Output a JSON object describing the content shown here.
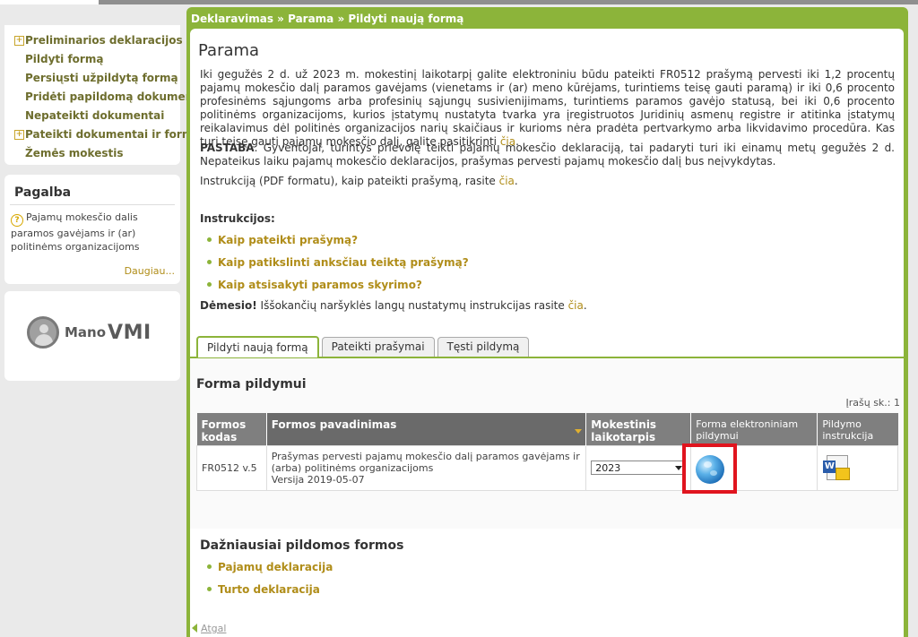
{
  "sidebar": {
    "menu": [
      {
        "label": "Preliminarios deklaracijos",
        "expandable": true
      },
      {
        "label": "Pildyti formą",
        "expandable": false
      },
      {
        "label": "Persiųsti užpildytą formą",
        "expandable": false
      },
      {
        "label": "Pridėti papildomą dokumentą",
        "expandable": false
      },
      {
        "label": "Nepateikti dokumentai",
        "expandable": false
      },
      {
        "label": "Pateikti dokumentai ir formos",
        "expandable": true
      },
      {
        "label": "Žemės mokestis",
        "expandable": false
      }
    ],
    "help": {
      "title": "Pagalba",
      "item": "Pajamų mokesčio dalis paramos gavėjams ir (ar) politinėms organizacijoms",
      "more": "Daugiau..."
    },
    "logo": {
      "prefix": "Mano",
      "name": "VMI"
    }
  },
  "breadcrumb": "Deklaravimas » Parama » Pildyti naują formą",
  "page": {
    "title": "Parama",
    "intro": "Iki gegužės 2 d. už 2023 m. mokestinį laikotarpį galite elektroniniu būdu pateikti FR0512 prašymą pervesti iki 1,2 procentų pajamų mokesčio dalį paramos gavėjams (vienetams ir (ar) meno kūrėjams, turintiems teisę gauti paramą) ir iki 0,6 procento profesinėms sąjungoms arba profesinių sąjungų susivienijimams, turintiems paramos gavėjo statusą, bei iki 0,6 procento politinėms organizacijoms, kurios įstatymų nustatyta tvarka yra įregistruotos Juridinių asmenų registre ir atitinka įstatymų reikalavimus dėl politinės organizacijos narių skaičiaus ir kurioms nėra pradėta pertvarkymo arba likvidavimo procedūra. Kas turi teisę gauti pajamų mokesčio dalį, galite pasitikrinti ",
    "intro_link": "čia",
    "intro_end": ".",
    "note_label": "PASTABA",
    "note_text": ". Gyventojai, turintys prievolę teikti pajamų mokesčio deklaraciją, tai padaryti turi iki einamų metų gegužės 2 d. Nepateikus laiku pajamų mokesčio deklaracijos, prašymas pervesti pajamų mokesčio dalį bus neįvykdytas.",
    "pdf_text": "Instrukciją (PDF formatu), kaip pateikti prašymą, rasite ",
    "pdf_link": "čia",
    "pdf_end": ".",
    "instructions_title": "Instrukcijos:",
    "instructions": [
      "Kaip pateikti prašymą?",
      "Kaip patikslinti anksčiau teiktą prašymą?",
      "Kaip atsisakyti paramos skyrimo?"
    ],
    "attention_label": "Dėmesio!",
    "attention_text": " Iššokančių naršyklės langų nustatymų instrukcijas rasite ",
    "attention_link": "čia",
    "attention_end": "."
  },
  "tabs": [
    "Pildyti naują formą",
    "Pateikti prašymai",
    "Tęsti pildymą"
  ],
  "forms": {
    "title": "Forma pildymui",
    "count": "Įrašų sk.: 1",
    "headers": [
      "Formos kodas",
      "Formos pavadinimas",
      "Mokestinis laikotarpis",
      "Forma elektroniniam pildymui",
      "Pildymo instrukcija"
    ],
    "row": {
      "code": "FR0512 v.5",
      "name": "Prašymas pervesti pajamų mokesčio dalį paramos gavėjams ir (arba) politinėms organizacijoms",
      "version": "Versija 2019-05-07",
      "period": "2023"
    }
  },
  "frequent": {
    "title": "Dažniausiai pildomos formos",
    "items": [
      "Pajamų deklaracija",
      "Turto deklaracija"
    ]
  },
  "back": "Atgal",
  "colors": {
    "accent": "#8cb43a",
    "link": "#b08d19",
    "highlight": "#e0141e"
  }
}
